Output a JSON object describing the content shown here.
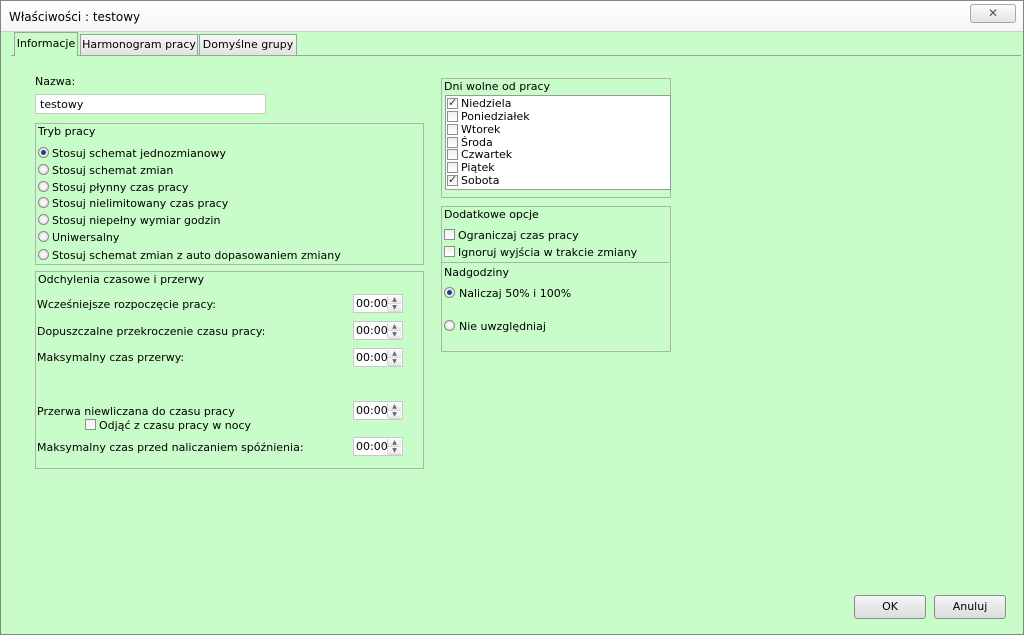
{
  "window": {
    "title": "Właściwości : testowy",
    "close_label": "✕"
  },
  "tabs": [
    "Informacje",
    "Harmonogram pracy",
    "Domyślne grupy"
  ],
  "name_field": {
    "label": "Nazwa:",
    "value": "testowy"
  },
  "work_mode": {
    "title": "Tryb pracy",
    "options": [
      {
        "label": "Stosuj schemat jednozmianowy",
        "selected": true
      },
      {
        "label": "Stosuj schemat zmian",
        "selected": false
      },
      {
        "label": "Stosuj płynny czas pracy",
        "selected": false
      },
      {
        "label": "Stosuj nielimitowany czas pracy",
        "selected": false
      },
      {
        "label": "Stosuj niepełny wymiar godzin",
        "selected": false
      },
      {
        "label": "Uniwersalny",
        "selected": false
      },
      {
        "label": "Stosuj schemat zmian z auto dopasowaniem zmiany",
        "selected": false
      }
    ]
  },
  "deviations": {
    "title": "Odchylenia czasowe i przerwy",
    "rows": [
      {
        "label": "Wcześniejsze rozpoczęcie pracy:",
        "value": "00:00"
      },
      {
        "label": "Dopuszczalne przekroczenie czasu pracy:",
        "value": "00:00"
      },
      {
        "label": "Maksymalny czas przerwy:",
        "value": "00:00"
      },
      {
        "label": "Przerwa niewliczana do czasu pracy",
        "value": "00:00"
      },
      {
        "label": "Maksymalny czas przed naliczaniem spóźnienia:",
        "value": "00:00"
      }
    ],
    "night_checkbox": {
      "label": "Odjąć z czasu pracy w nocy",
      "checked": false
    }
  },
  "days_off": {
    "title": "Dni wolne od pracy",
    "days": [
      {
        "label": "Niedziela",
        "checked": true
      },
      {
        "label": "Poniedziałek",
        "checked": false
      },
      {
        "label": "Wtorek",
        "checked": false
      },
      {
        "label": "Środa",
        "checked": false
      },
      {
        "label": "Czwartek",
        "checked": false
      },
      {
        "label": "Piątek",
        "checked": false
      },
      {
        "label": "Sobota",
        "checked": true
      }
    ]
  },
  "extra_options": {
    "title": "Dodatkowe opcje",
    "options": [
      {
        "label": "Ograniczaj czas pracy",
        "checked": false
      },
      {
        "label": "Ignoruj wyjścia w trakcie zmiany",
        "checked": false
      }
    ]
  },
  "overtime": {
    "title": "Nadgodziny",
    "options": [
      {
        "label": "Naliczaj 50% i 100%",
        "selected": true
      },
      {
        "label": "Nie uwzględniaj",
        "selected": false
      }
    ]
  },
  "buttons": {
    "ok": "OK",
    "cancel": "Anuluj"
  }
}
